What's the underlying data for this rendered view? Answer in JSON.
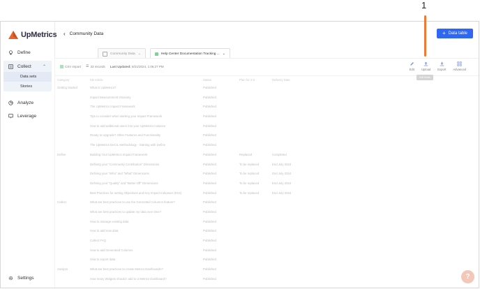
{
  "annotation": {
    "number": "1"
  },
  "app": {
    "name": "UpMetrics",
    "brand_color": "#e8662c"
  },
  "sidebar": {
    "items": [
      {
        "label": "Define",
        "icon": "lightbulb-icon"
      },
      {
        "label": "Collect",
        "icon": "clipboard-icon"
      },
      {
        "label": "Analyze",
        "icon": "chart-pie-icon"
      },
      {
        "label": "Leverage",
        "icon": "presentation-icon"
      }
    ],
    "collect_sub": [
      {
        "label": "Data sets"
      },
      {
        "label": "Stories"
      }
    ],
    "settings_label": "Settings"
  },
  "header": {
    "title": "Community Data",
    "primary_button": "Data table"
  },
  "tabs": [
    {
      "label": "Community Data"
    },
    {
      "label": "Help Center Documentation Tracking ..."
    }
  ],
  "toolbar": {
    "csv": "CSV import",
    "records": "33 records",
    "last_updated_label": "Last Updated:",
    "last_updated_value": "8/21/2024, 1:06:27 PM",
    "actions": [
      "Edit",
      "Upload",
      "Export",
      "Advanced"
    ],
    "tooltip": "Edit fields"
  },
  "table": {
    "headers": [
      "Category",
      "KB Article",
      "Status",
      "Plan for 2.0",
      "Delivery Date"
    ],
    "rows": [
      [
        "Getting Started",
        "What is UpMetrics?",
        "Published",
        "",
        ""
      ],
      [
        "",
        "Impact Measurement Glossary",
        "Published",
        "",
        ""
      ],
      [
        "",
        "The UpMetrics Impact Framework",
        "Published",
        "",
        ""
      ],
      [
        "",
        "Tips to consider when starting your Impact Framework",
        "Published",
        "",
        ""
      ],
      [
        "",
        "How to add additional users into your UpMetrics instance",
        "Published",
        "",
        ""
      ],
      [
        "",
        "Ready to Upgrade? Other Features and Functionality",
        "Published",
        "",
        ""
      ],
      [
        "",
        "The UpMetrics DeCIL Methodology - Starting with Define",
        "Published",
        "",
        ""
      ],
      [
        "Define",
        "Building Your UpMetrics Impact Framework",
        "Published",
        "Replaced",
        "Completed"
      ],
      [
        "",
        "Defining your \"Community Contribution\" Dimensions",
        "Published",
        "To be replaced",
        "End July 2024"
      ],
      [
        "",
        "Defining your \"Who\" and \"What\" Dimensions",
        "Published",
        "To be replaced",
        "End July 2024"
      ],
      [
        "",
        "Defining your \"Quality\" and \"Better Off\" Dimensions",
        "Published",
        "To be replaced",
        "End July 2024"
      ],
      [
        "",
        "Best Practices for setting Objectives and Key Impact Indicators (KIIs)",
        "Published",
        "To be replaced",
        "End July 2024"
      ],
      [
        "Collect",
        "What are best practices to use the Generated Columns feature?",
        "Published",
        "",
        ""
      ],
      [
        "",
        "What are best practices to update my data over time?",
        "Published",
        "",
        ""
      ],
      [
        "",
        "How to manage existing data",
        "Published",
        "",
        ""
      ],
      [
        "",
        "How to add new data",
        "Published",
        "",
        ""
      ],
      [
        "",
        "Collect FAQ",
        "Published",
        "",
        ""
      ],
      [
        "",
        "How to add Generated Columns",
        "Published",
        "",
        ""
      ],
      [
        "",
        "How to export data",
        "Published",
        "",
        ""
      ],
      [
        "Analyze",
        "What are best practices to create Metrics Dashboards?",
        "Published",
        "",
        ""
      ],
      [
        "",
        "How many Widgets should I add to a Metrics Dashboard?",
        "Published",
        "",
        ""
      ]
    ]
  }
}
